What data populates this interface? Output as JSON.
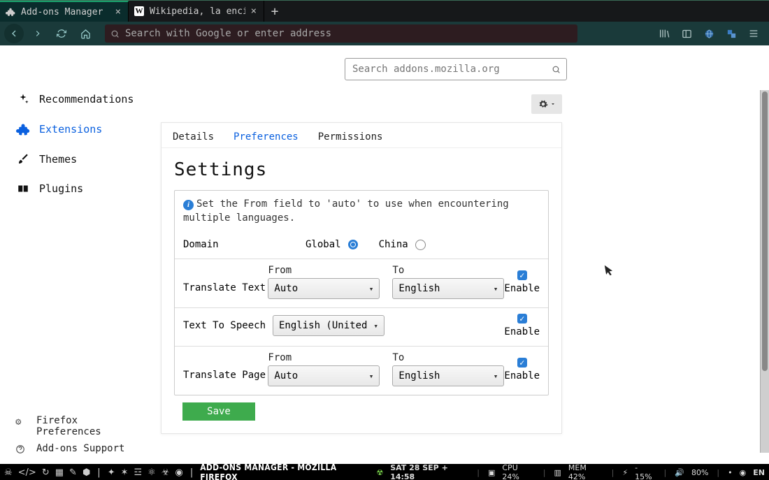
{
  "tabs": [
    {
      "title": "Add-ons Manager"
    },
    {
      "title": "Wikipedia, la enci"
    }
  ],
  "urlbar_placeholder": "Search with Google or enter address",
  "sidebar": {
    "recommendations": "Recommendations",
    "extensions": "Extensions",
    "themes": "Themes",
    "plugins": "Plugins",
    "firefox_prefs_l1": "Firefox",
    "firefox_prefs_l2": "Preferences",
    "addons_support": "Add-ons Support"
  },
  "amo_search_placeholder": "Search addons.mozilla.org",
  "card_tabs": {
    "details": "Details",
    "preferences": "Preferences",
    "permissions": "Permissions"
  },
  "card": {
    "heading": "Settings",
    "info": "Set the From field to 'auto' to use when encountering multiple languages.",
    "domain_label": "Domain",
    "domain_global": "Global",
    "domain_china": "China",
    "translate_text_label": "Translate Text",
    "from_label": "From",
    "to_label": "To",
    "translate_text_from": "Auto",
    "translate_text_to": "English",
    "tts_label": "Text To Speech",
    "tts_value": "English (United",
    "translate_page_label": "Translate Page",
    "translate_page_from": "Auto",
    "translate_page_to": "English",
    "enable_label": "Enable",
    "save": "Save"
  },
  "taskbar": {
    "window_title": "Add-ons Manager - Mozilla Firefox",
    "datetime": "SAT 28 SEP + 14:58",
    "cpu": "CPU 24%",
    "mem": "MEM 42%",
    "bat": "- 15%",
    "vol": "80%",
    "lang": "EN"
  }
}
